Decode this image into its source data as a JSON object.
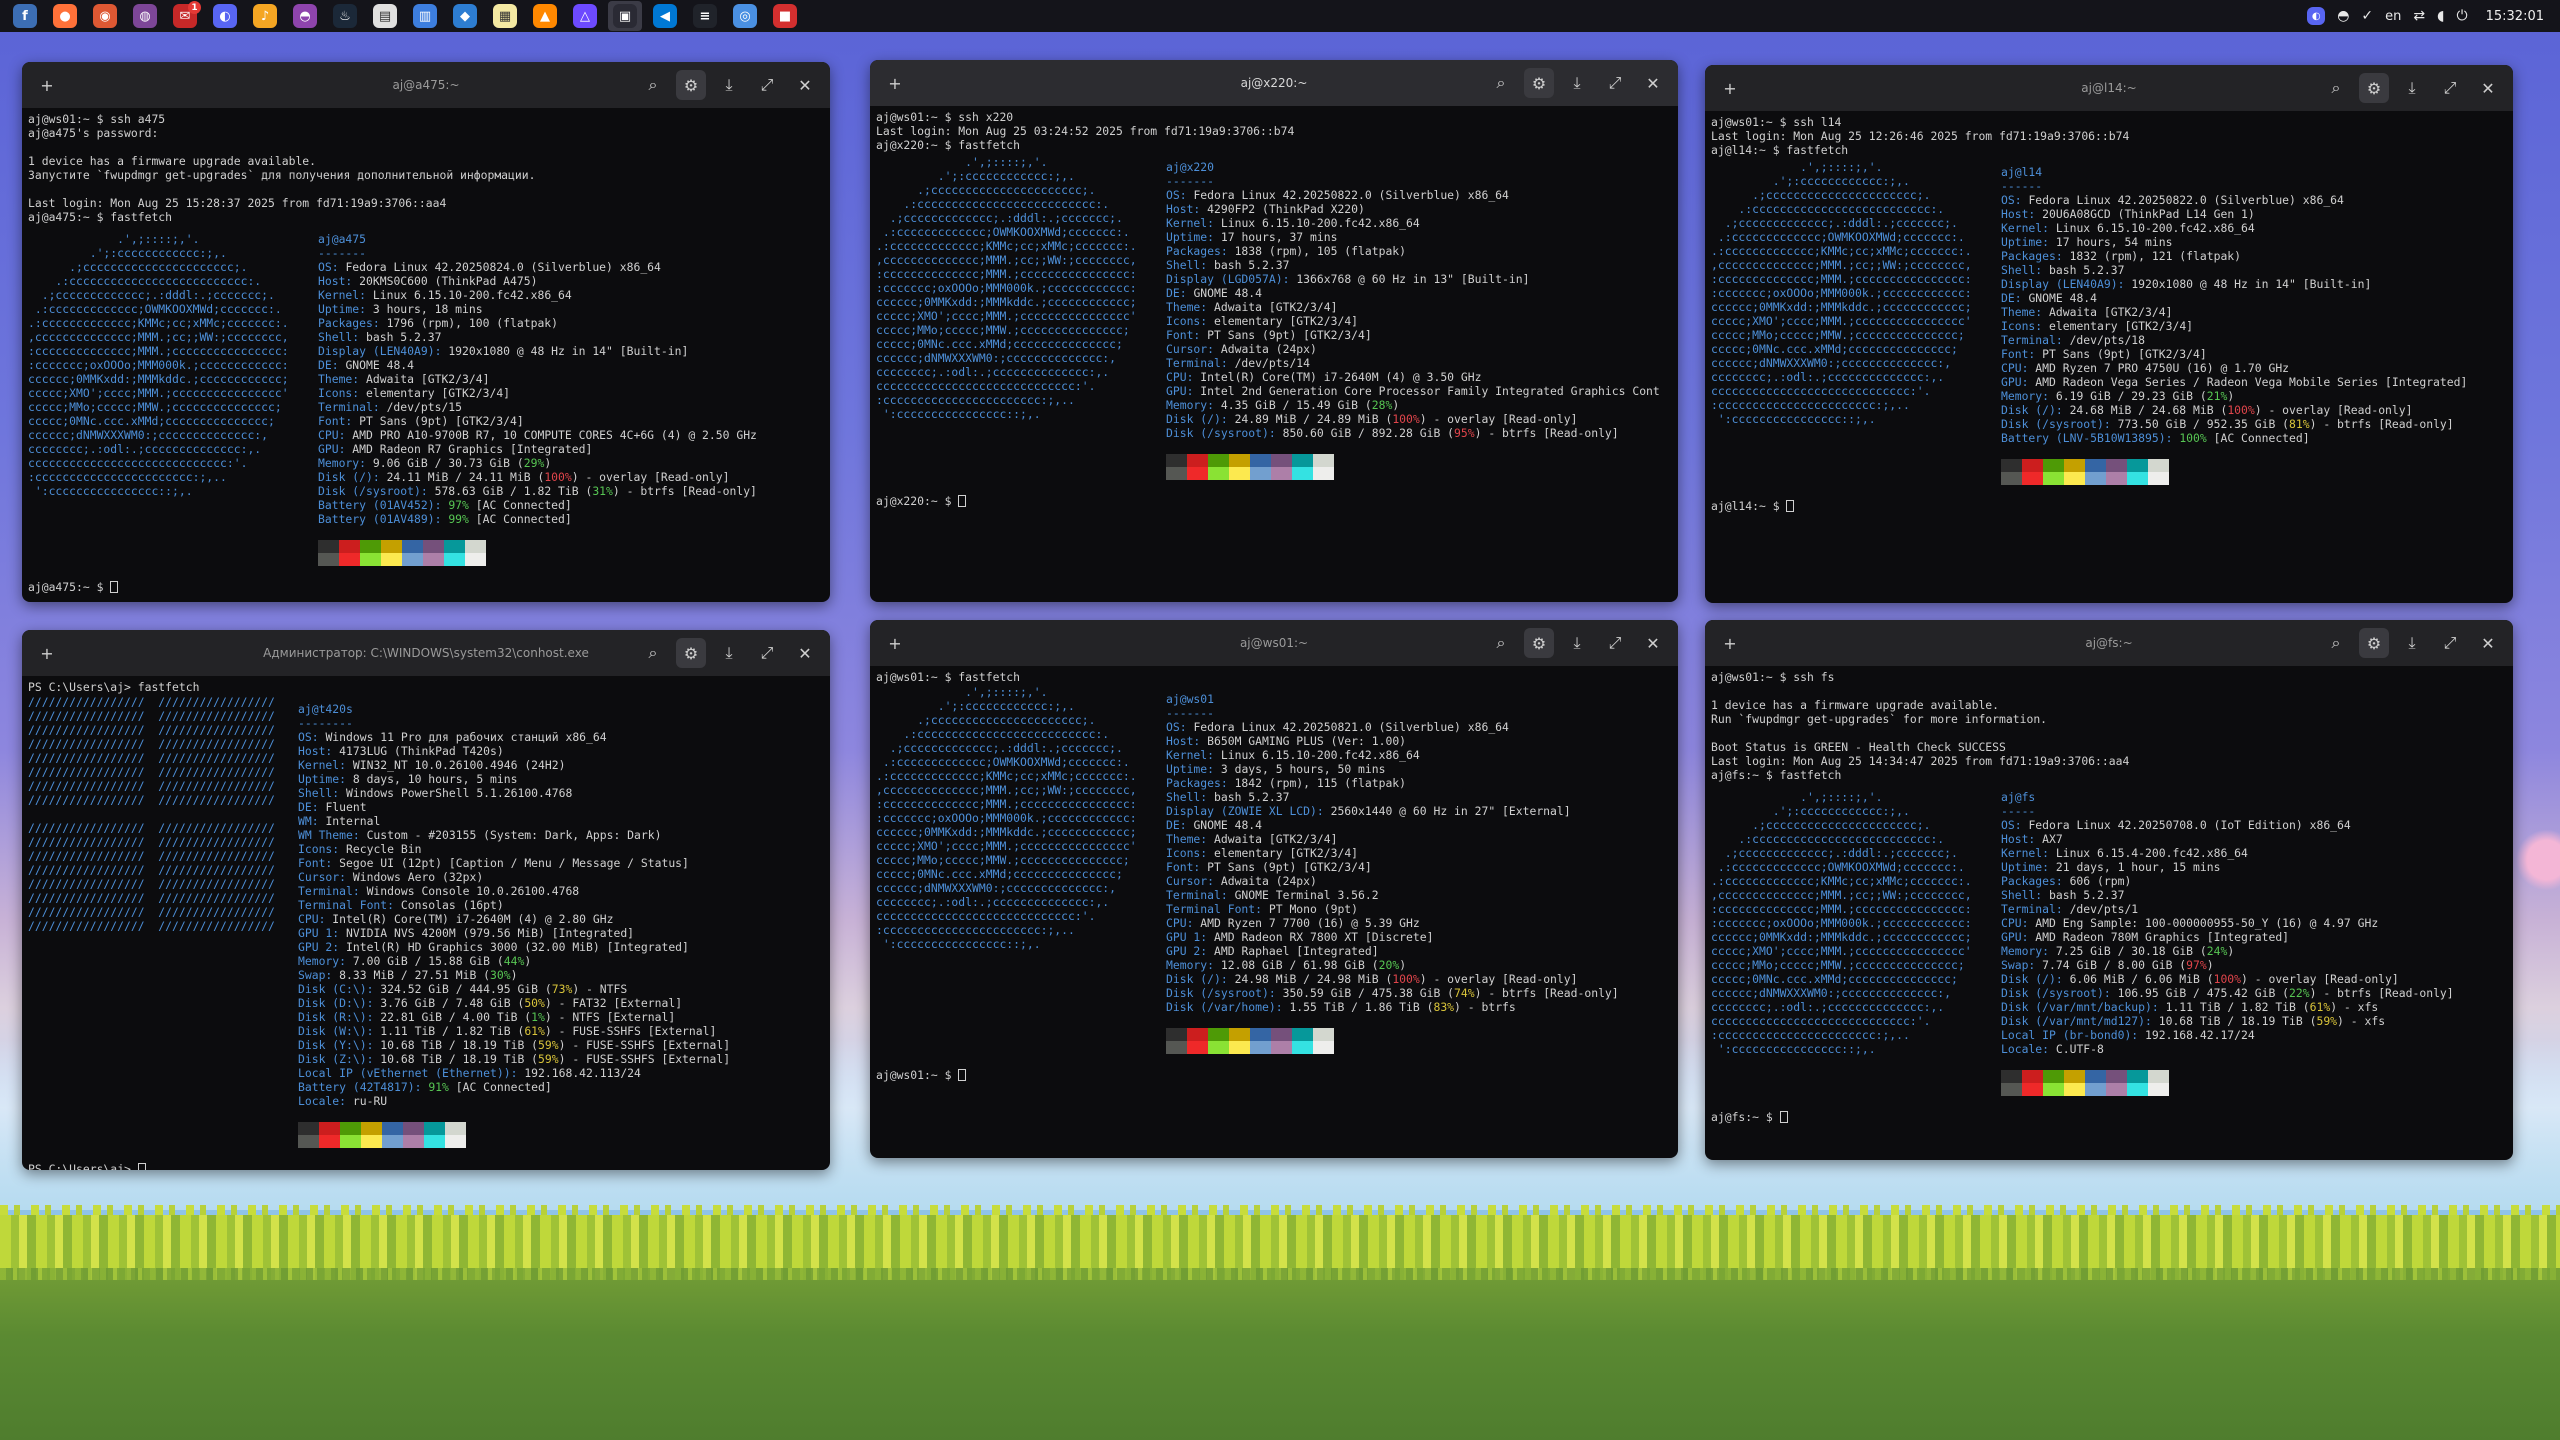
{
  "topbar": {
    "apps": [
      {
        "name": "fedora-icon",
        "color": "#3c6eb4",
        "glyph": "f"
      },
      {
        "name": "firefox-icon",
        "color": "#ff7139",
        "glyph": "●"
      },
      {
        "name": "duckduckgo-icon",
        "color": "#de5833",
        "glyph": "◉"
      },
      {
        "name": "tor-browser-icon",
        "color": "#7d4698",
        "glyph": "◍"
      },
      {
        "name": "mail-icon",
        "color": "#c62828",
        "glyph": "✉",
        "badge": "1"
      },
      {
        "name": "discord-icon",
        "color": "#5865f2",
        "glyph": "◐"
      },
      {
        "name": "amberol-icon",
        "color": "#f5a623",
        "glyph": "♪"
      },
      {
        "name": "headset-icon",
        "color": "#8e44ad",
        "glyph": "◓"
      },
      {
        "name": "steam-icon",
        "color": "#1b2838",
        "glyph": "♨"
      },
      {
        "name": "files-icon",
        "color": "#e0e0e0",
        "glyph": "▤"
      },
      {
        "name": "document-icon",
        "color": "#3d7ede",
        "glyph": "▥"
      },
      {
        "name": "drop-icon",
        "color": "#2d7dd2",
        "glyph": "◆"
      },
      {
        "name": "notes-icon",
        "color": "#f4e9a3",
        "glyph": "▦"
      },
      {
        "name": "vlc-icon",
        "color": "#ff8800",
        "glyph": "▲"
      },
      {
        "name": "proton-vpn-icon",
        "color": "#6d4aff",
        "glyph": "△"
      },
      {
        "name": "terminal-icon",
        "color": "#2a2a34",
        "glyph": "▣",
        "active": true
      },
      {
        "name": "vscode-icon",
        "color": "#0078d4",
        "glyph": "◀"
      },
      {
        "name": "server-icon",
        "color": "#20232a",
        "glyph": "≡"
      },
      {
        "name": "chromium-icon",
        "color": "#4a90e2",
        "glyph": "◎"
      },
      {
        "name": "camera-icon",
        "color": "#d32f2f",
        "glyph": "■"
      }
    ],
    "tray": {
      "discord": "discord-tray-icon",
      "language": "en",
      "clock": "15:32:01"
    }
  },
  "windows": [
    {
      "id": "a475",
      "title": "aj@a475:~",
      "lines": [
        "aj@ws01:~ $ ssh a475",
        "aj@a475's password:",
        "",
        "1 device has a firmware upgrade available.",
        "Запустите `fwupdmgr get-upgrades` для получения дополнительной информации.",
        "",
        "Last login: Mon Aug 25 15:28:37 2025 from fd71:19a9:3706::aa4",
        "aj@a475:~ $ fastfetch"
      ],
      "info": [
        [
          "",
          "aj@a475"
        ],
        [
          "",
          "-------"
        ],
        [
          "OS",
          "Fedora Linux 42.20250824.0 (Silverblue) x86_64"
        ],
        [
          "Host",
          "20KMS0C600 (ThinkPad A475)"
        ],
        [
          "Kernel",
          "Linux 6.15.10-200.fc42.x86_64"
        ],
        [
          "Uptime",
          "3 hours, 18 mins"
        ],
        [
          "Packages",
          "1796 (rpm), 100 (flatpak)"
        ],
        [
          "Shell",
          "bash 5.2.37"
        ],
        [
          "Display (LEN40A9)",
          "1920x1080 @ 48 Hz in 14\" [Built-in]"
        ],
        [
          "DE",
          "GNOME 48.4"
        ],
        [
          "Theme",
          "Adwaita [GTK2/3/4]"
        ],
        [
          "Icons",
          "elementary [GTK2/3/4]"
        ],
        [
          "Terminal",
          "/dev/pts/15"
        ],
        [
          "Font",
          "PT Sans (9pt) [GTK2/3/4]"
        ],
        [
          "CPU",
          "AMD PRO A10-9700B R7, 10 COMPUTE CORES 4C+6G (4) @ 2.50 GHz"
        ],
        [
          "GPU",
          "AMD Radeon R7 Graphics [Integrated]"
        ],
        [
          "Memory",
          "9.06 GiB / 30.73 GiB (29%)"
        ],
        [
          "Disk (/)",
          "24.11 MiB / 24.11 MiB (100%) - overlay [Read-only]"
        ],
        [
          "Disk (/sysroot)",
          "578.63 GiB / 1.82 TiB (31%) - btrfs [Read-only]"
        ],
        [
          "Battery (01AV452)",
          "97% [AC Connected]"
        ],
        [
          "Battery (01AV489)",
          "99% [AC Connected]"
        ]
      ],
      "prompt": "aj@a475:~ $"
    },
    {
      "id": "x220",
      "title": "aj@x220:~",
      "lines": [
        "aj@ws01:~ $ ssh x220",
        "Last login: Mon Aug 25 03:24:52 2025 from fd71:19a9:3706::b74",
        "aj@x220:~ $ fastfetch"
      ],
      "info": [
        [
          "",
          "aj@x220"
        ],
        [
          "",
          "-------"
        ],
        [
          "OS",
          "Fedora Linux 42.20250822.0 (Silverblue) x86_64"
        ],
        [
          "Host",
          "4290FP2 (ThinkPad X220)"
        ],
        [
          "Kernel",
          "Linux 6.15.10-200.fc42.x86_64"
        ],
        [
          "Uptime",
          "17 hours, 37 mins"
        ],
        [
          "Packages",
          "1838 (rpm), 105 (flatpak)"
        ],
        [
          "Shell",
          "bash 5.2.37"
        ],
        [
          "Display (LGD057A)",
          "1366x768 @ 60 Hz in 13\" [Built-in]"
        ],
        [
          "DE",
          "GNOME 48.4"
        ],
        [
          "Theme",
          "Adwaita [GTK2/3/4]"
        ],
        [
          "Icons",
          "elementary [GTK2/3/4]"
        ],
        [
          "Font",
          "PT Sans (9pt) [GTK2/3/4]"
        ],
        [
          "Cursor",
          "Adwaita (24px)"
        ],
        [
          "Terminal",
          "/dev/pts/14"
        ],
        [
          "CPU",
          "Intel(R) Core(TM) i7-2640M (4) @ 3.50 GHz"
        ],
        [
          "GPU",
          "Intel 2nd Generation Core Processor Family Integrated Graphics Cont"
        ],
        [
          "Memory",
          "4.35 GiB / 15.49 GiB (28%)"
        ],
        [
          "Disk (/)",
          "24.89 MiB / 24.89 MiB (100%) - overlay [Read-only]"
        ],
        [
          "Disk (/sysroot)",
          "850.60 GiB / 892.28 GiB (95%) - btrfs [Read-only]"
        ]
      ],
      "prompt": "aj@x220:~ $"
    },
    {
      "id": "l14",
      "title": "aj@l14:~",
      "lines": [
        "aj@ws01:~ $ ssh l14",
        "Last login: Mon Aug 25 12:26:46 2025 from fd71:19a9:3706::b74",
        "aj@l14:~ $ fastfetch"
      ],
      "info": [
        [
          "",
          "aj@l14"
        ],
        [
          "",
          "------"
        ],
        [
          "OS",
          "Fedora Linux 42.20250822.0 (Silverblue) x86_64"
        ],
        [
          "Host",
          "20U6A08GCD (ThinkPad L14 Gen 1)"
        ],
        [
          "Kernel",
          "Linux 6.15.10-200.fc42.x86_64"
        ],
        [
          "Uptime",
          "17 hours, 54 mins"
        ],
        [
          "Packages",
          "1832 (rpm), 121 (flatpak)"
        ],
        [
          "Shell",
          "bash 5.2.37"
        ],
        [
          "Display (LEN40A9)",
          "1920x1080 @ 48 Hz in 14\" [Built-in]"
        ],
        [
          "DE",
          "GNOME 48.4"
        ],
        [
          "Theme",
          "Adwaita [GTK2/3/4]"
        ],
        [
          "Icons",
          "elementary [GTK2/3/4]"
        ],
        [
          "Terminal",
          "/dev/pts/18"
        ],
        [
          "Font",
          "PT Sans (9pt) [GTK2/3/4]"
        ],
        [
          "CPU",
          "AMD Ryzen 7 PRO 4750U (16) @ 1.70 GHz"
        ],
        [
          "GPU",
          "AMD Radeon Vega Series / Radeon Vega Mobile Series [Integrated]"
        ],
        [
          "Memory",
          "6.19 GiB / 29.23 GiB (21%)"
        ],
        [
          "Disk (/)",
          "24.68 MiB / 24.68 MiB (100%) - overlay [Read-only]"
        ],
        [
          "Disk (/sysroot)",
          "773.50 GiB / 952.35 GiB (81%) - btrfs [Read-only]"
        ],
        [
          "Battery (LNV-5B10W13895)",
          "100% [AC Connected]"
        ]
      ],
      "prompt": "aj@l14:~ $"
    },
    {
      "id": "win",
      "title": "Администратор: C:\\WINDOWS\\system32\\conhost.exe",
      "lines": [
        "PS C:\\Users\\aj> fastfetch"
      ],
      "info": [
        [
          "",
          "aj@t420s"
        ],
        [
          "",
          "--------"
        ],
        [
          "OS",
          "Windows 11 Pro для рабочих станций x86_64"
        ],
        [
          "Host",
          "4173LUG (ThinkPad T420s)"
        ],
        [
          "Kernel",
          "WIN32_NT 10.0.26100.4946 (24H2)"
        ],
        [
          "Uptime",
          "8 days, 10 hours, 5 mins"
        ],
        [
          "Shell",
          "Windows PowerShell 5.1.26100.4768"
        ],
        [
          "DE",
          "Fluent"
        ],
        [
          "WM",
          "Internal"
        ],
        [
          "WM Theme",
          "Custom - #203155 (System: Dark, Apps: Dark)"
        ],
        [
          "Icons",
          "Recycle Bin"
        ],
        [
          "Font",
          "Segoe UI (12pt) [Caption / Menu / Message / Status]"
        ],
        [
          "Cursor",
          "Windows Aero (32px)"
        ],
        [
          "Terminal",
          "Windows Console 10.0.26100.4768"
        ],
        [
          "Terminal Font",
          "Consolas (16pt)"
        ],
        [
          "CPU",
          "Intel(R) Core(TM) i7-2640M (4) @ 2.80 GHz"
        ],
        [
          "GPU 1",
          "NVIDIA NVS 4200M (979.56 MiB) [Integrated]"
        ],
        [
          "GPU 2",
          "Intel(R) HD Graphics 3000 (32.00 MiB) [Integrated]"
        ],
        [
          "Memory",
          "7.00 GiB / 15.88 GiB (44%)"
        ],
        [
          "Swap",
          "8.33 MiB / 27.51 MiB (30%)"
        ],
        [
          "Disk (C:\\)",
          "324.52 GiB / 444.95 GiB (73%) - NTFS"
        ],
        [
          "Disk (D:\\)",
          "3.76 GiB / 7.48 GiB (50%) - FAT32 [External]"
        ],
        [
          "Disk (R:\\)",
          "22.81 GiB / 4.00 TiB (1%) - NTFS [External]"
        ],
        [
          "Disk (W:\\)",
          "1.11 TiB / 1.82 TiB (61%) - FUSE-SSHFS [External]"
        ],
        [
          "Disk (Y:\\)",
          "10.68 TiB / 18.19 TiB (59%) - FUSE-SSHFS [External]"
        ],
        [
          "Disk (Z:\\)",
          "10.68 TiB / 18.19 TiB (59%) - FUSE-SSHFS [External]"
        ],
        [
          "Local IP (vEthernet (Ethernet))",
          "192.168.42.113/24"
        ],
        [
          "Battery (42T4817)",
          "91% [AC Connected]"
        ],
        [
          "Locale",
          "ru-RU"
        ]
      ],
      "prompt": "PS C:\\Users\\aj>"
    },
    {
      "id": "ws01",
      "title": "aj@ws01:~",
      "lines": [
        "aj@ws01:~ $ fastfetch"
      ],
      "info": [
        [
          "",
          "aj@ws01"
        ],
        [
          "",
          "-------"
        ],
        [
          "OS",
          "Fedora Linux 42.20250821.0 (Silverblue) x86_64"
        ],
        [
          "Host",
          "B650M GAMING PLUS (Ver: 1.00)"
        ],
        [
          "Kernel",
          "Linux 6.15.10-200.fc42.x86_64"
        ],
        [
          "Uptime",
          "3 days, 5 hours, 50 mins"
        ],
        [
          "Packages",
          "1842 (rpm), 115 (flatpak)"
        ],
        [
          "Shell",
          "bash 5.2.37"
        ],
        [
          "Display (ZOWIE XL LCD)",
          "2560x1440 @ 60 Hz in 27\" [External]"
        ],
        [
          "DE",
          "GNOME 48.4"
        ],
        [
          "Theme",
          "Adwaita [GTK2/3/4]"
        ],
        [
          "Icons",
          "elementary [GTK2/3/4]"
        ],
        [
          "Font",
          "PT Sans (9pt) [GTK2/3/4]"
        ],
        [
          "Cursor",
          "Adwaita (24px)"
        ],
        [
          "Terminal",
          "GNOME Terminal 3.56.2"
        ],
        [
          "Terminal Font",
          "PT Mono (9pt)"
        ],
        [
          "CPU",
          "AMD Ryzen 7 7700 (16) @ 5.39 GHz"
        ],
        [
          "GPU 1",
          "AMD Radeon RX 7800 XT [Discrete]"
        ],
        [
          "GPU 2",
          "AMD Raphael [Integrated]"
        ],
        [
          "Memory",
          "12.08 GiB / 61.98 GiB (20%)"
        ],
        [
          "Disk (/)",
          "24.98 MiB / 24.98 MiB (100%) - overlay [Read-only]"
        ],
        [
          "Disk (/sysroot)",
          "350.59 GiB / 475.38 GiB (74%) - btrfs [Read-only]"
        ],
        [
          "Disk (/var/home)",
          "1.55 TiB / 1.86 TiB (83%) - btrfs"
        ]
      ],
      "prompt": "aj@ws01:~ $"
    },
    {
      "id": "fs",
      "title": "aj@fs:~",
      "lines": [
        "aj@ws01:~ $ ssh fs",
        "",
        "1 device has a firmware upgrade available.",
        "Run `fwupdmgr get-upgrades` for more information.",
        "",
        "Boot Status is GREEN - Health Check SUCCESS",
        "Last login: Mon Aug 25 14:34:47 2025 from fd71:19a9:3706::aa4",
        "aj@fs:~ $ fastfetch"
      ],
      "info": [
        [
          "",
          "aj@fs"
        ],
        [
          "",
          "-----"
        ],
        [
          "OS",
          "Fedora Linux 42.20250708.0 (IoT Edition) x86_64"
        ],
        [
          "Host",
          "AX7"
        ],
        [
          "Kernel",
          "Linux 6.15.4-200.fc42.x86_64"
        ],
        [
          "Uptime",
          "21 days, 1 hour, 15 mins"
        ],
        [
          "Packages",
          "606 (rpm)"
        ],
        [
          "Shell",
          "bash 5.2.37"
        ],
        [
          "Terminal",
          "/dev/pts/1"
        ],
        [
          "CPU",
          "AMD Eng Sample: 100-000000955-50_Y (16) @ 4.97 GHz"
        ],
        [
          "GPU",
          "AMD Radeon 780M Graphics [Integrated]"
        ],
        [
          "Memory",
          "7.25 GiB / 30.18 GiB (24%)"
        ],
        [
          "Swap",
          "7.74 GiB / 8.00 GiB (97%)"
        ],
        [
          "Disk (/)",
          "6.06 MiB / 6.06 MiB (100%) - overlay [Read-only]"
        ],
        [
          "Disk (/sysroot)",
          "106.95 GiB / 475.42 GiB (22%) - btrfs [Read-only]"
        ],
        [
          "Disk (/var/mnt/backup)",
          "1.11 TiB / 1.82 TiB (61%) - xfs"
        ],
        [
          "Disk (/var/mnt/md127)",
          "10.68 TiB / 18.19 TiB (59%) - xfs"
        ],
        [
          "Local IP (br-bond0)",
          "192.168.42.17/24"
        ],
        [
          "Locale",
          "C.UTF-8"
        ]
      ],
      "prompt": "aj@fs:~ $"
    }
  ],
  "palette": {
    "top": [
      "#2e2e2e",
      "#cc1e1e",
      "#4e9a06",
      "#c4a000",
      "#3465a4",
      "#75507b",
      "#06989a",
      "#d3d7cf"
    ],
    "bottom": [
      "#555753",
      "#ef2929",
      "#8ae234",
      "#fce94f",
      "#729fcf",
      "#ad7fa8",
      "#34e2e2",
      "#eeeeec"
    ]
  }
}
